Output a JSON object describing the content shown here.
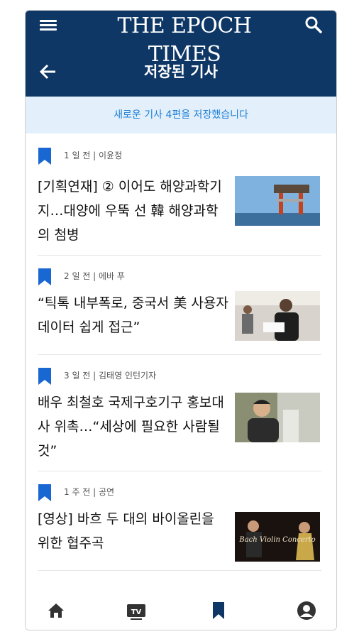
{
  "header": {
    "masthead": "THE EPOCH TIMES",
    "page_title": "저장된 기사"
  },
  "notice": "새로운 기사 4편을 저장했습니다",
  "articles": [
    {
      "meta": "1 일 전 | 이윤정",
      "title": "[기획연재] ② 이어도 해양과학기지…대양에 우뚝 선 韓 해양과학의 첨병",
      "thumb": "ocean-research-platform"
    },
    {
      "meta": "2 일 전 | 에바 푸",
      "title": "“틱톡 내부폭로, 중국서 美 사용자 데이터 쉽게 접근”",
      "thumb": "tiktok-office"
    },
    {
      "meta": "3 일 전 | 김태영 인턴기자",
      "title": "배우 최철호 국제구호기구 홍보대사 위촉…“세상에 필요한 사람될 것”",
      "thumb": "actor-portrait"
    },
    {
      "meta": "1 주 전 | 공연",
      "title": "[영상] 바흐 두 대의 바이올린을 위한 협주곡",
      "thumb": "violin-concert",
      "thumb_caption": "Bach Violin Concerto"
    }
  ],
  "tabs": [
    "home",
    "tv",
    "bookmarks",
    "profile"
  ],
  "tab_icon_label": "TV",
  "colors": {
    "header_bg": "#0e3766",
    "accent": "#1967d2",
    "notice_bg": "#e3f0fb"
  }
}
